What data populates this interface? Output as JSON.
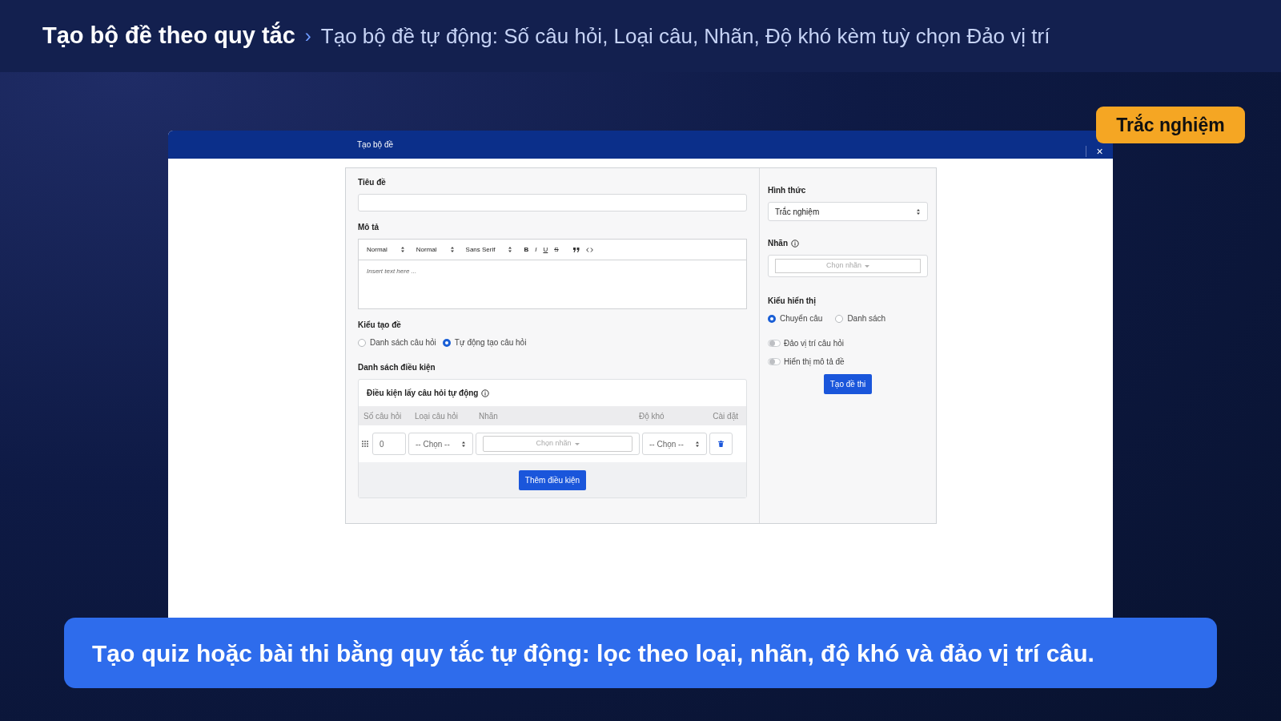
{
  "header": {
    "title": "Tạo bộ đề theo quy tắc",
    "separator": "›",
    "subtitle": "Tạo bộ đề tự động: Số câu hỏi, Loại câu, Nhãn, Độ khó kèm tuỳ chọn Đảo vị trí"
  },
  "badge": "Trắc nghiệm",
  "dialog": {
    "title": "Tạo bộ đề",
    "close": "×",
    "left": {
      "title_label": "Tiêu đề",
      "description_label": "Mô tả",
      "editor": {
        "toolbar": [
          {
            "kind": "select",
            "label": "Normal"
          },
          {
            "kind": "select",
            "label": "Normal"
          },
          {
            "kind": "select",
            "label": "Sans Serif"
          },
          {
            "kind": "bold",
            "label": "B"
          },
          {
            "kind": "italic",
            "label": "I"
          },
          {
            "kind": "underline",
            "label": "U"
          },
          {
            "kind": "strike",
            "label": "S"
          },
          {
            "kind": "quote"
          },
          {
            "kind": "code"
          }
        ],
        "placeholder": "Insert text here ..."
      },
      "mode_label": "Kiểu tạo đề",
      "modes": [
        {
          "label": "Danh sách câu hỏi",
          "selected": false
        },
        {
          "label": "Tự động tạo câu hỏi",
          "selected": true
        }
      ],
      "conditions_label": "Danh sách điều kiện",
      "conditions": {
        "title": "Điều kiện lấy câu hỏi tự động",
        "columns": [
          "Số câu hỏi",
          "Loại câu hỏi",
          "Nhãn",
          "Độ khó",
          "Cài đặt"
        ],
        "rows": [
          {
            "count": "0",
            "type": "-- Chọn --",
            "tags": "Chọn nhãn",
            "difficulty": "-- Chọn --"
          }
        ],
        "add_button": "Thêm điều kiện"
      }
    },
    "right": {
      "format_label": "Hình thức",
      "format_value": "Trắc nghiệm",
      "tags_label": "Nhãn",
      "tags_placeholder": "Chọn nhãn",
      "display_label": "Kiểu hiển thị",
      "display_modes": [
        {
          "label": "Chuyển câu",
          "selected": true
        },
        {
          "label": "Danh sách",
          "selected": false
        }
      ],
      "toggles": [
        {
          "label": "Đảo vị trí câu hỏi",
          "on": false
        },
        {
          "label": "Hiển thị mô tả đề",
          "on": false
        }
      ],
      "submit": "Tạo đề thi"
    }
  },
  "caption": "Tạo quiz hoặc bài thi bằng quy tắc tự động: lọc theo loại, nhãn, độ khó và đảo vị trí câu."
}
